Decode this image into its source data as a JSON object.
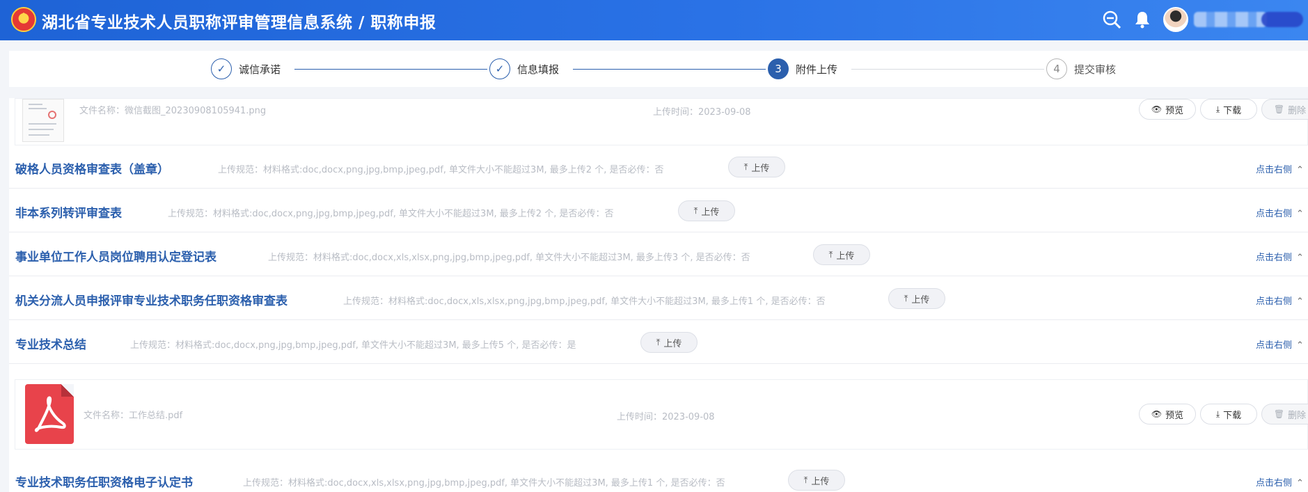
{
  "header": {
    "title": "湖北省专业技术人员职称评审管理信息系统 / 职称申报",
    "icons": [
      "zoom-out-icon",
      "bell-icon"
    ]
  },
  "steps": [
    {
      "label": "诚信承诺",
      "marker": "✓",
      "state": "done"
    },
    {
      "label": "信息填报",
      "marker": "✓",
      "state": "done"
    },
    {
      "label": "附件上传",
      "marker": "3",
      "state": "active"
    },
    {
      "label": "提交审核",
      "marker": "4",
      "state": "todo"
    }
  ],
  "file_top": {
    "name": "文件名称：微信截图_20230908105941.png",
    "time": "上传时间：2023-09-08",
    "preview": "预览",
    "download": "下载",
    "delete": "删除"
  },
  "sections": [
    {
      "title": "破格人员资格审查表（盖章）",
      "rule": "上传规范：材料格式:doc,docx,png,jpg,bmp,jpeg,pdf, 单文件大小不能超过3M, 最多上传2 个, 是否必传：否",
      "upload": "上传",
      "toggle": "点击右侧"
    },
    {
      "title": "非本系列转评审查表",
      "rule": "上传规范：材料格式:doc,docx,png,jpg,bmp,jpeg,pdf, 单文件大小不能超过3M, 最多上传2 个, 是否必传：否",
      "upload": "上传",
      "toggle": "点击右侧"
    },
    {
      "title": "事业单位工作人员岗位聘用认定登记表",
      "rule": "上传规范：材料格式:doc,docx,xls,xlsx,png,jpg,bmp,jpeg,pdf, 单文件大小不能超过3M, 最多上传3 个, 是否必传：否",
      "upload": "上传",
      "toggle": "点击右侧"
    },
    {
      "title": "机关分流人员申报评审专业技术职务任职资格审查表",
      "rule": "上传规范：材料格式:doc,docx,xls,xlsx,png,jpg,bmp,jpeg,pdf, 单文件大小不能超过3M, 最多上传1 个, 是否必传：否",
      "upload": "上传",
      "toggle": "点击右侧"
    },
    {
      "title": "专业技术总结",
      "rule": "上传规范：材料格式:doc,docx,png,jpg,bmp,jpeg,pdf, 单文件大小不能超过3M, 最多上传5 个, 是否必传：是",
      "upload": "上传",
      "toggle": "点击右侧"
    },
    {
      "title": "专业技术职务任职资格电子认定书",
      "rule": "上传规范：材料格式:doc,docx,xls,xlsx,png,jpg,bmp,jpeg,pdf, 单文件大小不能超过3M, 最多上传1 个, 是否必传：否",
      "upload": "上传",
      "toggle": "点击右侧"
    }
  ],
  "file_pdf": {
    "name": "文件名称：工作总结.pdf",
    "time": "上传时间：2023-09-08",
    "preview": "预览",
    "download": "下载",
    "delete": "删除"
  }
}
